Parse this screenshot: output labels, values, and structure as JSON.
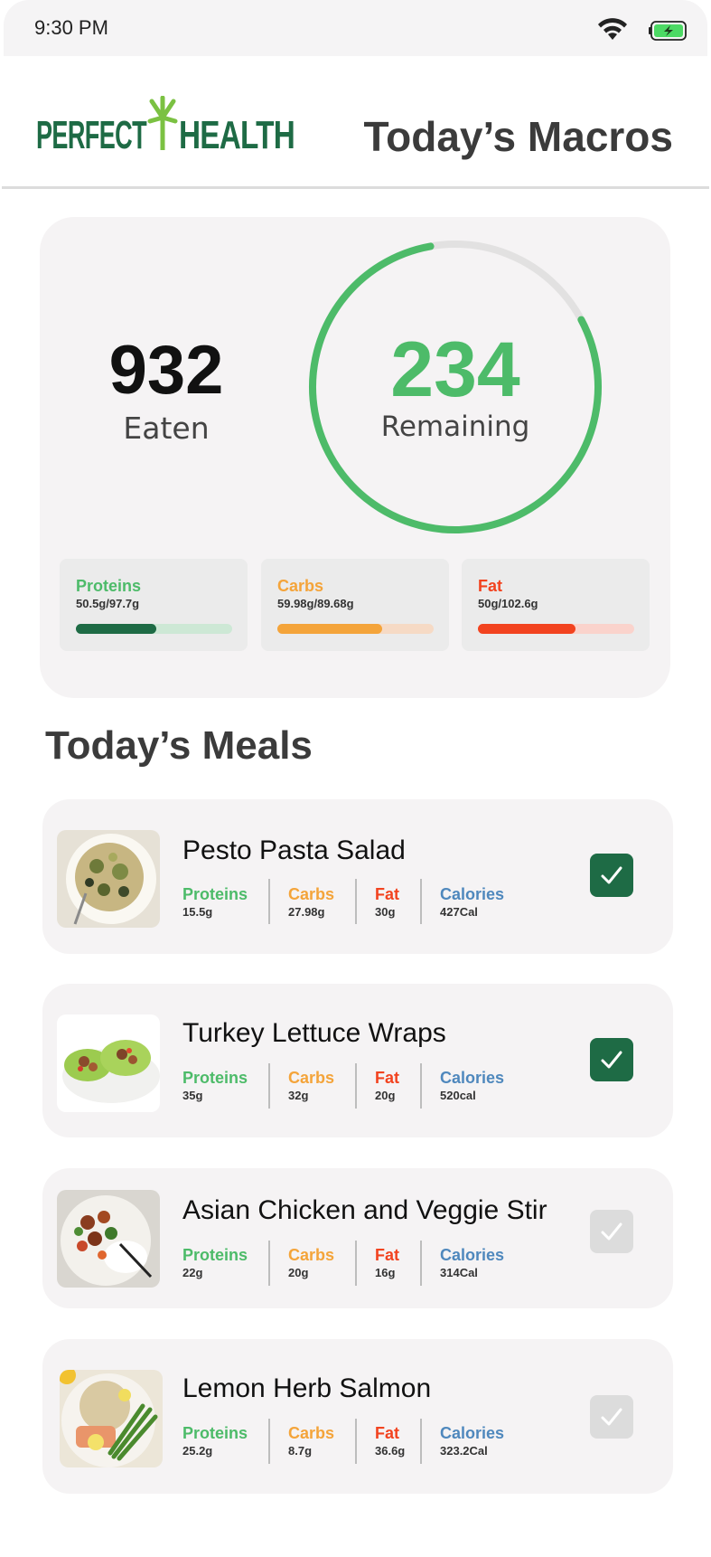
{
  "status_bar": {
    "time": "9:30 PM",
    "wifi_icon": "wifi-icon",
    "battery_icon": "battery-charging-icon"
  },
  "header": {
    "brand_left": "PERFECT",
    "brand_right": "HEALTH",
    "logo_icon": "palm-tree-icon",
    "title": "Today’s Macros"
  },
  "colors": {
    "brand_green": "#1e6b45",
    "remaining_green": "#4dbb69",
    "protein": "#4dbb69",
    "protein_bar": "#1e6b45",
    "protein_track": "#cde8d5",
    "carbs": "#f4a43a",
    "carbs_track": "#f6dac5",
    "fat": "#f2431f",
    "fat_track": "#fad3cc",
    "calories": "#4f88bd",
    "check_on": "#1e6b45",
    "check_off": "#dcdcdc"
  },
  "summary": {
    "eaten_value": "932",
    "eaten_label": "Eaten",
    "remaining_value": "234",
    "remaining_label": "Remaining",
    "ring_progress": 0.8
  },
  "macros": [
    {
      "name": "Proteins",
      "amount": "50.5g/97.7g",
      "progress": 0.517
    },
    {
      "name": "Carbs",
      "amount": "59.98g/89.68g",
      "progress": 0.669
    },
    {
      "name": "Fat",
      "amount": "50g/102.6g",
      "progress": 0.623
    }
  ],
  "meals_title": "Today’s Meals",
  "nutrient_labels": {
    "proteins": "Proteins",
    "carbs": "Carbs",
    "fat": "Fat",
    "calories": "Calories"
  },
  "meals": [
    {
      "name": "Pesto Pasta Salad",
      "proteins": "15.5g",
      "carbs": "27.98g",
      "fat": "30g",
      "calories": "427Cal",
      "checked": true
    },
    {
      "name": "Turkey Lettuce Wraps",
      "proteins": "35g",
      "carbs": "32g",
      "fat": "20g",
      "calories": "520cal",
      "checked": true
    },
    {
      "name": "Asian Chicken and Veggie Stir",
      "proteins": "22g",
      "carbs": "20g",
      "fat": "16g",
      "calories": "314Cal",
      "checked": false
    },
    {
      "name": "Lemon Herb Salmon",
      "proteins": "25.2g",
      "carbs": "8.7g",
      "fat": "36.6g",
      "calories": "323.2Cal",
      "checked": false
    }
  ]
}
